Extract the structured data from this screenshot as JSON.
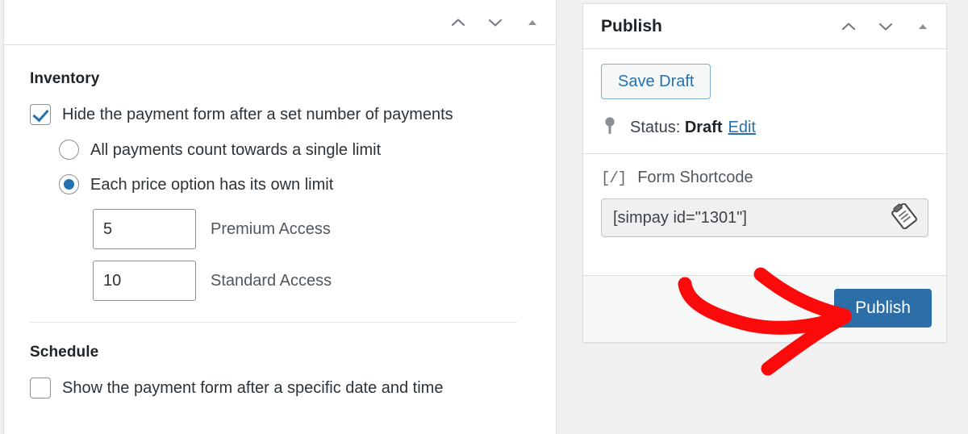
{
  "main_panel": {
    "header_icons": [
      "chevron-up-icon",
      "chevron-down-icon",
      "triangle-toggle-icon"
    ],
    "inventory": {
      "title": "Inventory",
      "enable_checkbox": {
        "label": "Hide the payment form after a set number of payments",
        "checked": true
      },
      "limit_mode_options": [
        {
          "label": "All payments count towards a single limit",
          "selected": false
        },
        {
          "label": "Each price option has its own limit",
          "selected": true
        }
      ],
      "price_option_limits": [
        {
          "value": "5",
          "caption": "Premium Access"
        },
        {
          "value": "10",
          "caption": "Standard Access"
        }
      ]
    },
    "schedule": {
      "title": "Schedule",
      "enable_checkbox": {
        "label": "Show the payment form after a specific date and time",
        "checked": false
      }
    }
  },
  "publish_panel": {
    "title": "Publish",
    "header_icons": [
      "chevron-up-icon",
      "chevron-down-icon",
      "triangle-toggle-icon"
    ],
    "save_draft_label": "Save Draft",
    "status": {
      "icon": "pin-icon",
      "prefix": "Status:",
      "value": "Draft",
      "edit_link": "Edit"
    },
    "shortcode": {
      "icon": "shortcode-icon",
      "icon_glyph": "[/]",
      "label": "Form Shortcode",
      "value": "[simpay id=\"1301\"]",
      "copy_icon": "clipboard-copy-icon"
    },
    "publish_label": "Publish"
  },
  "annotation": {
    "arrow_color": "#fa0a0a",
    "points_to": "publish-button"
  },
  "colors": {
    "accent_blue": "#2271b1",
    "publish_blue": "#2c6fa8",
    "annotation_red": "#fa0a0a",
    "page_background": "#f0f0f1",
    "panel_border": "#dcdcde"
  }
}
